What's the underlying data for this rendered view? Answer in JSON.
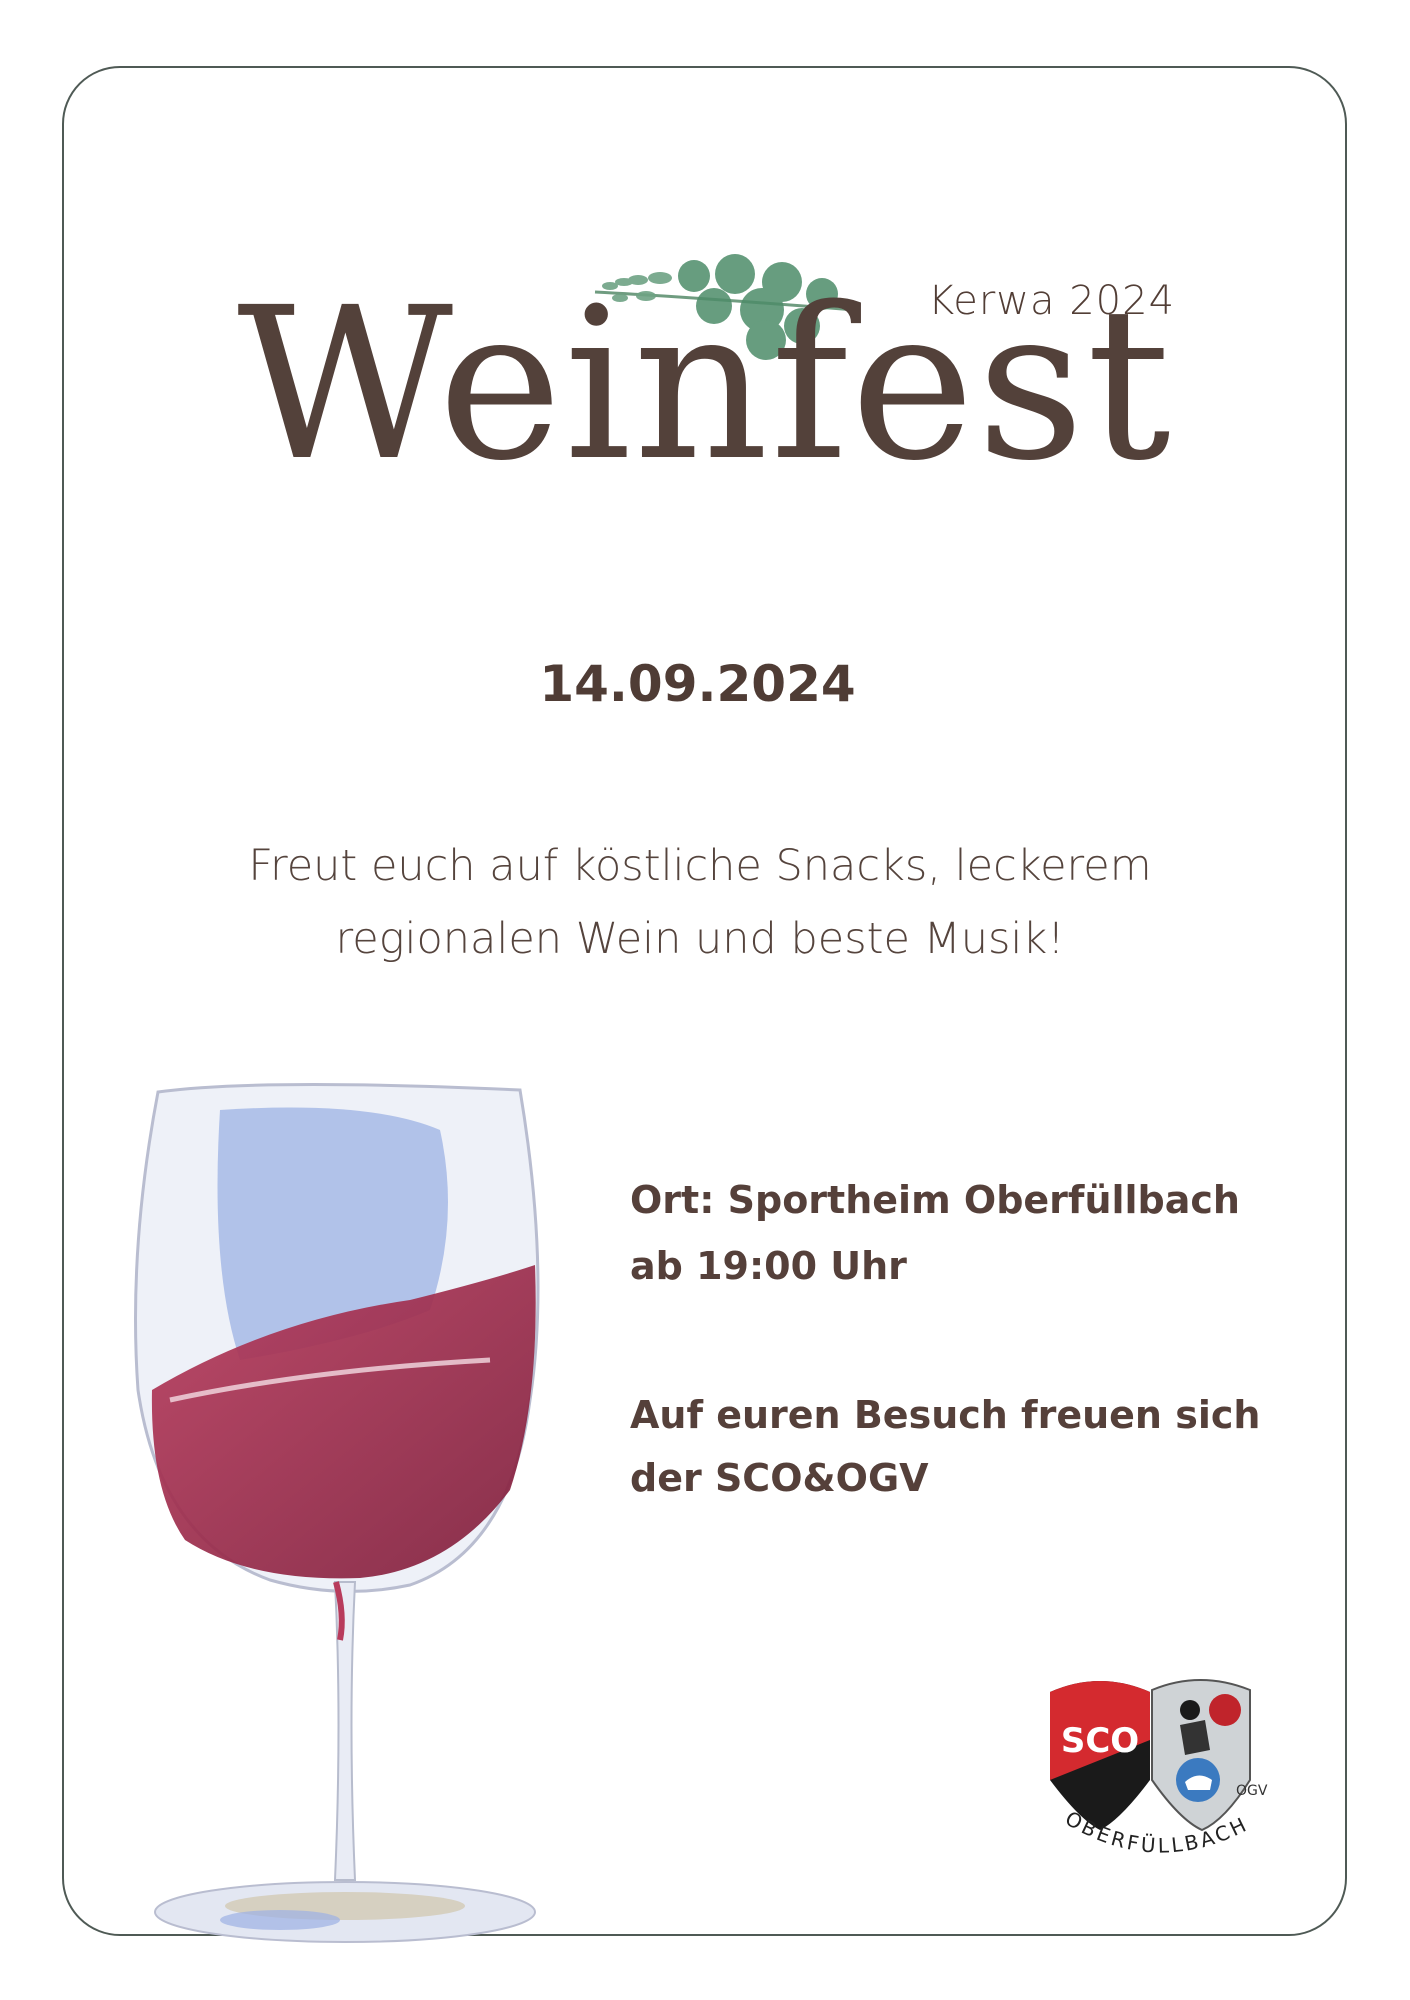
{
  "header": {
    "kicker": "Kerwa 2024",
    "title": "Weinfest"
  },
  "event": {
    "date": "14.09.2024",
    "tagline_line1": "Freut euch auf köstliche Snacks, leckerem",
    "tagline_line2": "regionalen Wein und beste Musik!"
  },
  "details": {
    "location": "Ort: Sportheim Oberfüllbach",
    "time": "ab 19:00 Uhr",
    "hosts_line1": "Auf euren Besuch freuen sich",
    "hosts_line2": "der SCO&OGV"
  },
  "logo": {
    "text_sco": "SCO",
    "text_ogv": "OGV",
    "arc_text": "OBERFÜLLBACH"
  },
  "colors": {
    "text": "#523e36",
    "border": "#4f5a55",
    "wine": "#9b2a47",
    "leaf": "#5e9a78"
  }
}
